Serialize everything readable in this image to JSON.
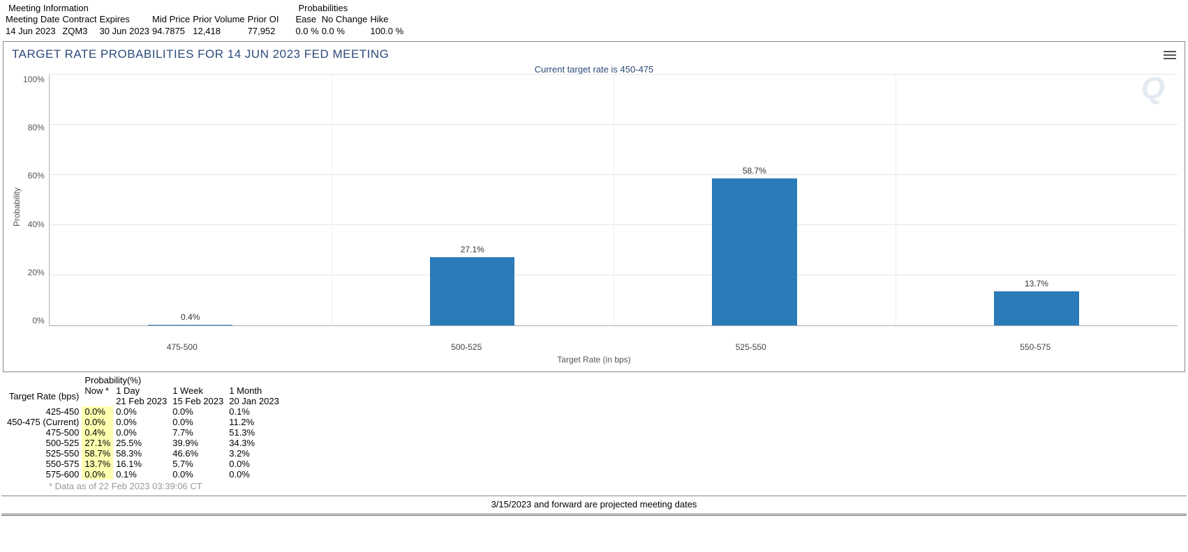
{
  "meeting_info": {
    "title": "Meeting Information",
    "headers": [
      "Meeting Date",
      "Contract",
      "Expires",
      "Mid Price",
      "Prior Volume",
      "Prior OI"
    ],
    "row": [
      "14 Jun 2023",
      "ZQM3",
      "30 Jun 2023",
      "94.7875",
      "12,418",
      "77,952"
    ]
  },
  "probabilities_top": {
    "title": "Probabilities",
    "headers": [
      "Ease",
      "No Change",
      "Hike"
    ],
    "row": [
      "0.0 %",
      "0.0 %",
      "100.0 %"
    ]
  },
  "chart": {
    "title": "TARGET RATE PROBABILITIES FOR 14 JUN 2023 FED MEETING",
    "subtitle": "Current target rate is 450-475",
    "xlabel": "Target Rate (in bps)",
    "ylabel": "Probability",
    "yticks": [
      "100%",
      "80%",
      "60%",
      "40%",
      "20%",
      "0%"
    ],
    "watermark": "Q"
  },
  "chart_data": {
    "type": "bar",
    "categories": [
      "475-500",
      "500-525",
      "525-550",
      "550-575"
    ],
    "values": [
      0.4,
      27.1,
      58.7,
      13.7
    ],
    "value_labels": [
      "0.4%",
      "27.1%",
      "58.7%",
      "13.7%"
    ],
    "title": "TARGET RATE PROBABILITIES FOR 14 JUN 2023 FED MEETING",
    "xlabel": "Target Rate (in bps)",
    "ylabel": "Probability",
    "ylim": [
      0,
      100
    ]
  },
  "history_table": {
    "header_group": "Probability(%)",
    "col1": "Target Rate (bps)",
    "cols": [
      "Now *",
      "1 Day",
      "1 Week",
      "1 Month"
    ],
    "col_dates": [
      "",
      "21 Feb 2023",
      "15 Feb 2023",
      "20 Jan 2023"
    ],
    "rows": [
      {
        "rate": "425-450",
        "vals": [
          "0.0%",
          "0.0%",
          "0.0%",
          "0.1%"
        ]
      },
      {
        "rate": "450-475 (Current)",
        "vals": [
          "0.0%",
          "0.0%",
          "0.0%",
          "11.2%"
        ]
      },
      {
        "rate": "475-500",
        "vals": [
          "0.4%",
          "0.0%",
          "7.7%",
          "51.3%"
        ]
      },
      {
        "rate": "500-525",
        "vals": [
          "27.1%",
          "25.5%",
          "39.9%",
          "34.3%"
        ]
      },
      {
        "rate": "525-550",
        "vals": [
          "58.7%",
          "58.3%",
          "46.6%",
          "3.2%"
        ]
      },
      {
        "rate": "550-575",
        "vals": [
          "13.7%",
          "16.1%",
          "5.7%",
          "0.0%"
        ]
      },
      {
        "rate": "575-600",
        "vals": [
          "0.0%",
          "0.1%",
          "0.0%",
          "0.0%"
        ]
      }
    ],
    "footnote": "* Data as of 22 Feb 2023 03:39:06 CT"
  },
  "bottom_note": "3/15/2023 and forward are projected meeting dates"
}
